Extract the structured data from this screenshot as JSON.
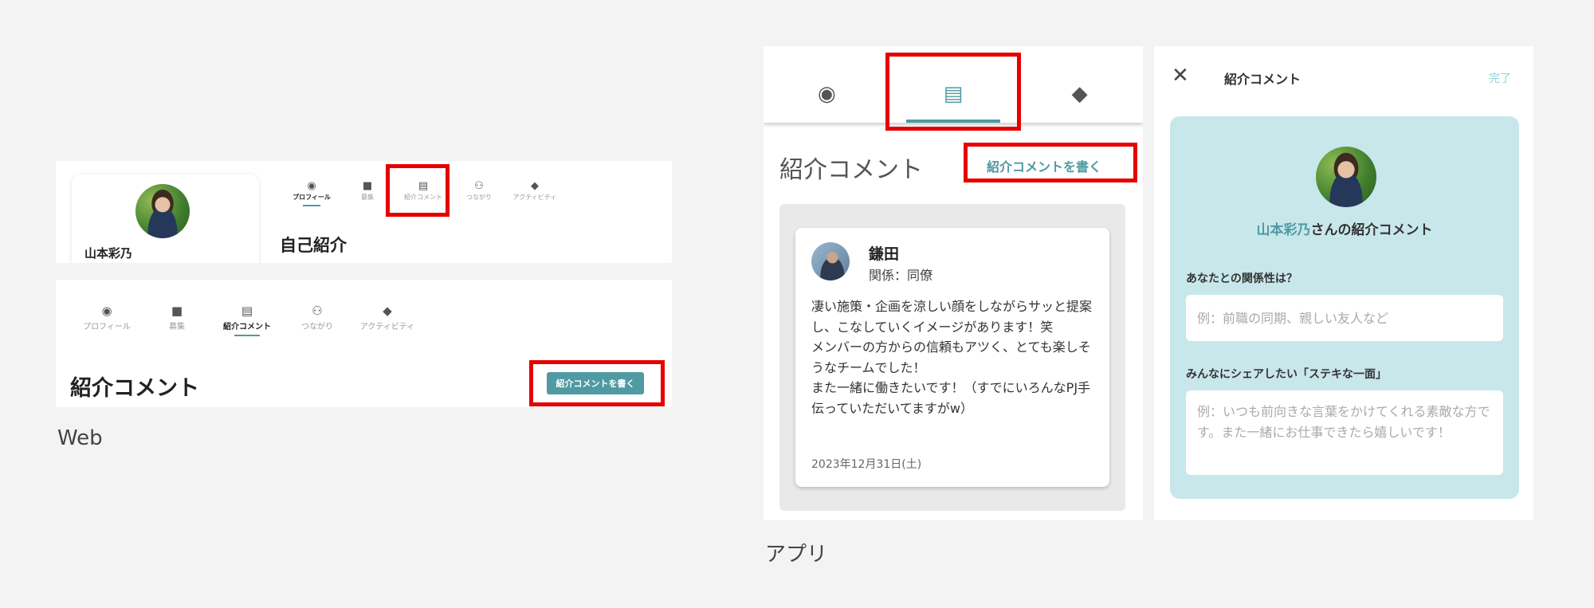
{
  "web": {
    "caption": "Web",
    "profile": {
      "name": "山本彩乃"
    },
    "tabs": [
      {
        "label": "プロフィール",
        "icon": "account-circle-icon"
      },
      {
        "label": "募集",
        "icon": "bag-icon"
      },
      {
        "label": "紹介コメント",
        "icon": "comment-icon"
      },
      {
        "label": "つながり",
        "icon": "people-icon"
      },
      {
        "label": "アクティビティ",
        "icon": "tag-icon"
      }
    ],
    "panel1_title": "自己紹介",
    "panel2_title": "紹介コメント",
    "write_button": "紹介コメントを書く"
  },
  "app": {
    "caption": "アプリ",
    "tabs": [
      {
        "icon": "account-circle-icon"
      },
      {
        "icon": "comment-icon"
      },
      {
        "icon": "tag-icon"
      }
    ],
    "title": "紹介コメント",
    "write_link": "紹介コメントを書く",
    "comment": {
      "name": "鎌田",
      "relation": "関係：同僚",
      "body": "凄い施策・企画を涼しい顔をしながらサッと提案し、こなしていくイメージがあります！笑\nメンバーの方からの信頼もアツく、とても楽しそうなチームでした！\nまた一緒に働きたいです！（すでにいろんなPJ手伝っていただいてますがw）",
      "date": "2023年12月31日(土)"
    },
    "form": {
      "header_title": "紹介コメント",
      "done_label": "完了",
      "target_name": "山本彩乃",
      "target_suffix": "さんの紹介コメント",
      "q1_label": "あなたとの関係性は？",
      "q1_placeholder": "例：前職の同期、親しい友人など",
      "q2_label": "みんなにシェアしたい「ステキな一面」",
      "q2_placeholder": "例：いつも前向きな言葉をかけてくれる素敵な方です。また一緒にお仕事できたら嬉しいです！"
    }
  },
  "colors": {
    "accent": "#4f9aa3",
    "highlight": "#e60000",
    "form_bg": "#c8e7ea"
  }
}
